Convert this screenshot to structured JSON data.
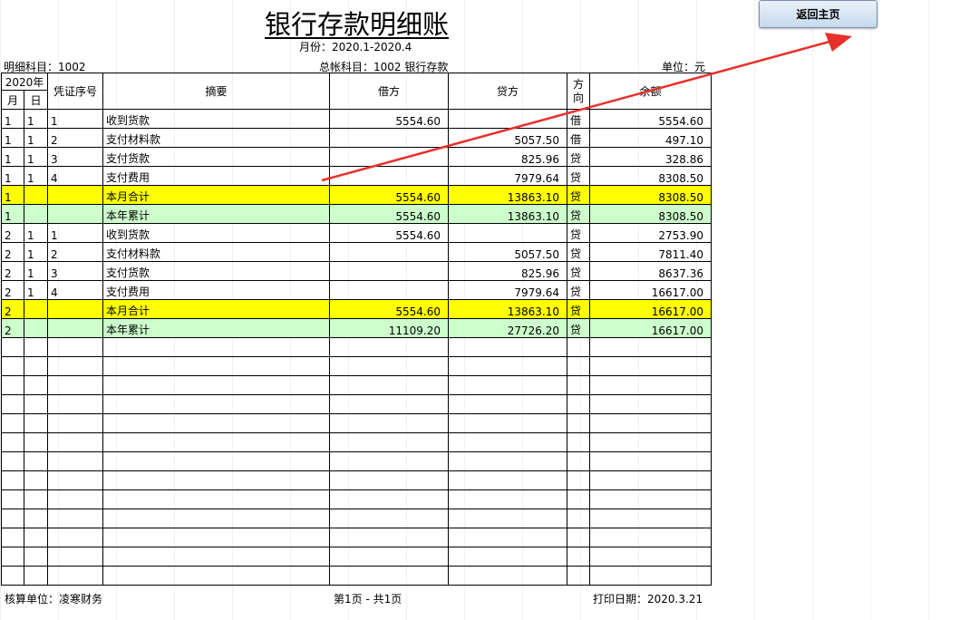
{
  "header": {
    "title": "银行存款明细账",
    "period": "月份：2020.1-2020.4",
    "detail_account": "明细科目：1002",
    "general_account": "总帐科目：1002  银行存款",
    "unit": "单位：元"
  },
  "return_button": "返回主页",
  "table": {
    "year_header": "2020年",
    "month_header": "月",
    "day_header": "日",
    "voucher_header": "凭证序号",
    "summary_header": "摘要",
    "debit_header": "借方",
    "credit_header": "贷方",
    "direction_header": "方向",
    "balance_header": "余额",
    "rows": [
      {
        "month": "1",
        "day": "1",
        "voucher": "1",
        "summary": "收到货款",
        "debit": "5554.60",
        "credit": "",
        "dir": "借",
        "balance": "5554.60"
      },
      {
        "month": "1",
        "day": "1",
        "voucher": "2",
        "summary": "支付材料款",
        "debit": "",
        "credit": "5057.50",
        "dir": "借",
        "balance": "497.10"
      },
      {
        "month": "1",
        "day": "1",
        "voucher": "3",
        "summary": "支付货款",
        "debit": "",
        "credit": "825.96",
        "dir": "贷",
        "balance": "328.86"
      },
      {
        "month": "1",
        "day": "1",
        "voucher": "4",
        "summary": "支付费用",
        "debit": "",
        "credit": "7979.64",
        "dir": "贷",
        "balance": "8308.50"
      },
      {
        "month": "1",
        "day": "",
        "voucher": "",
        "summary": "本月合计",
        "debit": "5554.60",
        "credit": "13863.10",
        "dir": "贷",
        "balance": "8308.50",
        "style": "yellow"
      },
      {
        "month": "1",
        "day": "",
        "voucher": "",
        "summary": "本年累计",
        "debit": "5554.60",
        "credit": "13863.10",
        "dir": "贷",
        "balance": "8308.50",
        "style": "green"
      },
      {
        "month": "2",
        "day": "1",
        "voucher": "1",
        "summary": "收到货款",
        "debit": "5554.60",
        "credit": "",
        "dir": "贷",
        "balance": "2753.90"
      },
      {
        "month": "2",
        "day": "1",
        "voucher": "2",
        "summary": "支付材料款",
        "debit": "",
        "credit": "5057.50",
        "dir": "贷",
        "balance": "7811.40"
      },
      {
        "month": "2",
        "day": "1",
        "voucher": "3",
        "summary": "支付货款",
        "debit": "",
        "credit": "825.96",
        "dir": "贷",
        "balance": "8637.36"
      },
      {
        "month": "2",
        "day": "1",
        "voucher": "4",
        "summary": "支付费用",
        "debit": "",
        "credit": "7979.64",
        "dir": "贷",
        "balance": "16617.00"
      },
      {
        "month": "2",
        "day": "",
        "voucher": "",
        "summary": "本月合计",
        "debit": "5554.60",
        "credit": "13863.10",
        "dir": "贷",
        "balance": "16617.00",
        "style": "yellow"
      },
      {
        "month": "2",
        "day": "",
        "voucher": "",
        "summary": "本年累计",
        "debit": "11109.20",
        "credit": "27726.20",
        "dir": "贷",
        "balance": "16617.00",
        "style": "green"
      }
    ]
  },
  "footer": {
    "accounting_unit": "核算单位：凌寒财务",
    "page": "第1页 - 共1页",
    "print_date": "打印日期：2020.3.21"
  },
  "colors": {
    "yellow_row": "#ffff00",
    "green_row": "#ccffcc",
    "arrow": "#e8302a"
  }
}
